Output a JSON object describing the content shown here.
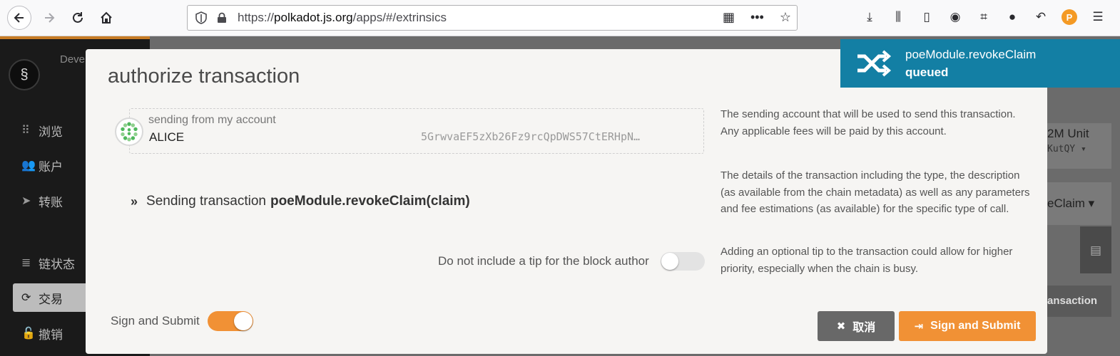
{
  "browser": {
    "url_prefix": "https://",
    "url_domain": "polkadot.js.org",
    "url_path": "/apps/#/extrinsics"
  },
  "sidebar": {
    "dev_label": "Deve",
    "items": [
      {
        "label": "浏览",
        "icon": "grid-icon"
      },
      {
        "label": "账户",
        "icon": "users-icon"
      },
      {
        "label": "转账",
        "icon": "send-icon"
      },
      {
        "label": "链状态",
        "icon": "database-icon"
      },
      {
        "label": "交易",
        "icon": "sync-icon",
        "active": true
      },
      {
        "label": "撤销",
        "icon": "unlock-icon"
      }
    ]
  },
  "background": {
    "unit_text": "2M Unit",
    "addr_suffix": "KutQY",
    "claim_text": "eClaim",
    "transaction_btn": "ansaction"
  },
  "toast": {
    "method": "poeModule.revokeClaim",
    "status": "queued"
  },
  "modal": {
    "title": "authorize transaction",
    "account": {
      "label": "sending from my account",
      "name": "ALICE",
      "address": "5GrwvaEF5zXb26Fz9rcQpDWS57CtERHpN…"
    },
    "sending_prefix": "Sending transaction",
    "sending_call": "poeModule.revokeClaim(claim)",
    "tip_label": "Do not include a tip for the block author",
    "help": [
      "The sending account that will be used to send this transaction. Any applicable fees will be paid by this account.",
      "The details of the transaction including the type, the description (as available from the chain metadata) as well as any parameters and fee estimations (as available) for the specific type of call.",
      "Adding an optional tip to the transaction could allow for higher priority, especially when the chain is busy."
    ],
    "sign_label": "Sign and Submit",
    "cancel_label": "取消",
    "submit_label": "Sign and Submit"
  },
  "colors": {
    "accent": "#f19135",
    "toast": "#137fa4"
  }
}
